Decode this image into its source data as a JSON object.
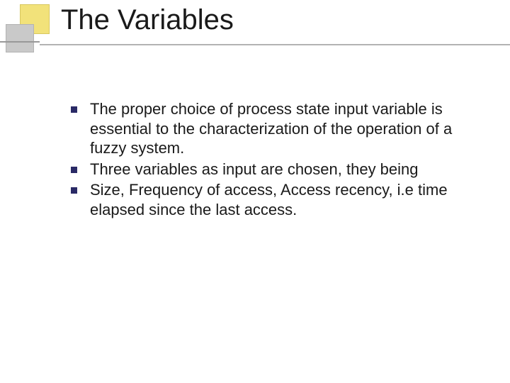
{
  "slide": {
    "title": "The Variables",
    "bullets": [
      "The proper choice of process state input variable is essential to the characterization of the operation of a fuzzy system.",
      "Three variables as input are chosen, they being",
      "Size, Frequency of access, Access recency, i.e time elapsed since the last access."
    ]
  }
}
